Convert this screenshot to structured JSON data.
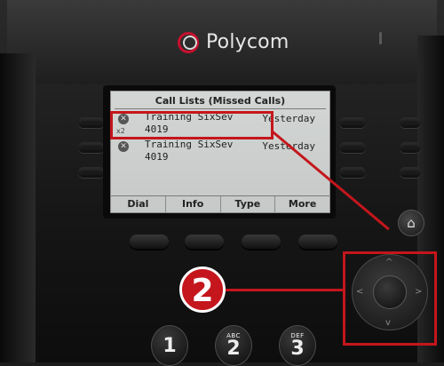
{
  "brand": {
    "name": "Polycom",
    "accent": "#c8102e"
  },
  "screen": {
    "title": "Call Lists (Missed Calls)",
    "calls": [
      {
        "caller": "Training SixSev",
        "ext": "4019",
        "when": "Yesterday",
        "multiplier": "x2",
        "icon": "missed-call-icon"
      },
      {
        "caller": "Training SixSev",
        "ext": "4019",
        "when": "Yesterday",
        "multiplier": "",
        "icon": "missed-call-icon"
      }
    ],
    "softkeys": [
      "Dial",
      "Info",
      "Type",
      "More"
    ]
  },
  "icons": {
    "home": "home-icon",
    "nav": "navigation-pad"
  },
  "keypad": [
    {
      "digit": "1",
      "letters": ""
    },
    {
      "digit": "2",
      "letters": "ABC"
    },
    {
      "digit": "3",
      "letters": "DEF"
    }
  ],
  "annotation": {
    "step": "2",
    "color": "#c4161c"
  }
}
